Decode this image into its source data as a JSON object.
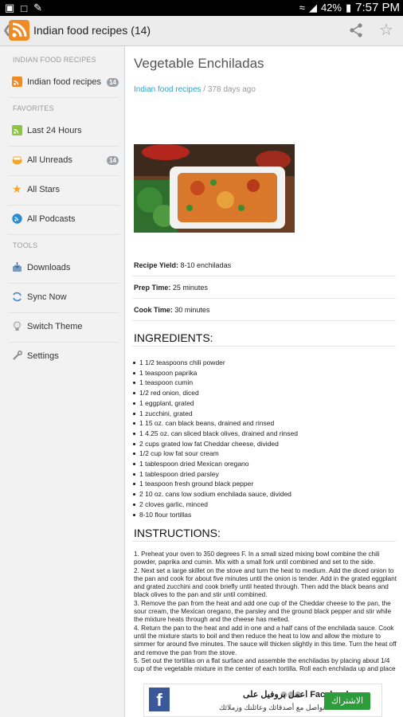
{
  "status": {
    "battery": "42%",
    "time": "7:57 PM"
  },
  "appbar": {
    "title": "Indian food recipes (14)"
  },
  "sidebar": {
    "sections": [
      "INDIAN FOOD RECIPES",
      "FAVORITES",
      "TOOLS"
    ],
    "items": [
      {
        "label": "Indian food recipes",
        "badge": "14",
        "icon": "rss-icon"
      },
      {
        "label": "Last 24 Hours",
        "badge": "",
        "icon": "rss-green-icon"
      },
      {
        "label": "All Unreads",
        "badge": "14",
        "icon": "unread-icon"
      },
      {
        "label": "All Stars",
        "badge": "",
        "icon": "star-icon"
      },
      {
        "label": "All Podcasts",
        "badge": "",
        "icon": "podcast-icon"
      },
      {
        "label": "Downloads",
        "badge": "",
        "icon": "download-icon"
      },
      {
        "label": "Sync Now",
        "badge": "",
        "icon": "sync-icon"
      },
      {
        "label": "Switch Theme",
        "badge": "",
        "icon": "bulb-icon"
      },
      {
        "label": "Settings",
        "badge": "",
        "icon": "tools-icon"
      }
    ]
  },
  "article": {
    "title": "Vegetable Enchiladas",
    "feed": "Indian food recipes",
    "age": " / 378 days ago",
    "yield_label": "Recipe Yield:",
    "yield_value": " 8-10 enchiladas",
    "prep_label": "Prep Time:",
    "prep_value": " 25 minutes",
    "cook_label": "Cook Time:",
    "cook_value": " 30 minutes",
    "ingredients_heading": "INGREDIENTS:",
    "ingredients": [
      "1 1/2 teaspoons chili powder",
      "1 teaspoon paprika",
      "1 teaspoon cumin",
      "1/2 red onion, diced",
      "1 eggplant, grated",
      "1 zucchini, grated",
      "1 15 oz. can black beans, drained and rinsed",
      "1 4.25 oz. can sliced black olives, drained and rinsed",
      "2 cups grated low fat Cheddar cheese, divided",
      "1/2 cup low fat sour cream",
      "1 tablespoon dried Mexican oregano",
      "1 tablespoon dried parsley",
      "1 teaspoon fresh ground black pepper",
      "2 10 oz. cans low sodium enchilada sauce, divided",
      "2 cloves garlic, minced",
      "8-10 flour tortillas"
    ],
    "instructions_heading": "INSTRUCTIONS:",
    "instructions": [
      "1. Preheat your oven to 350 degrees F. In a small sized mixing bowl combine the chili powder, paprika and cumin. Mix with a small fork until combined and set to the side.",
      "2. Next set a large skillet on the stove and turn the heat to medium. Add the diced onion to the pan and cook for about five minutes until the onion is tender. Add in the grated eggplant and grated zucchini and cook briefly until heated through. Then add the black beans and black olives to the pan and stir until combined.",
      "3. Remove the pan from the heat and add one cup of the Cheddar cheese to the pan, the sour cream, the Mexican oregano, the parsley and the ground black pepper and stir while the mixture heats through and the cheese has melted.",
      "4. Return the pan to the heat and add in one and a half cans of the enchilada sauce. Cook until the mixture starts to boil and then reduce the heat to low and allow the mixture to simmer for around five minutes. The sauce will thicken slightly in this time. Turn the heat off and remove the pan from the stove.",
      "5. Set out the tortillas on a flat surface and assemble the enchiladas by placing about 1/4 cup of the vegetable mixture in the center of each tortilla. Roll each enchilada up and place"
    ]
  },
  "ad": {
    "line1": "اعمل بروفيل على Facebook",
    "line2": "تواصل مع أصدقائك وعائلتك وزملائك",
    "button": "الاشتراك"
  }
}
